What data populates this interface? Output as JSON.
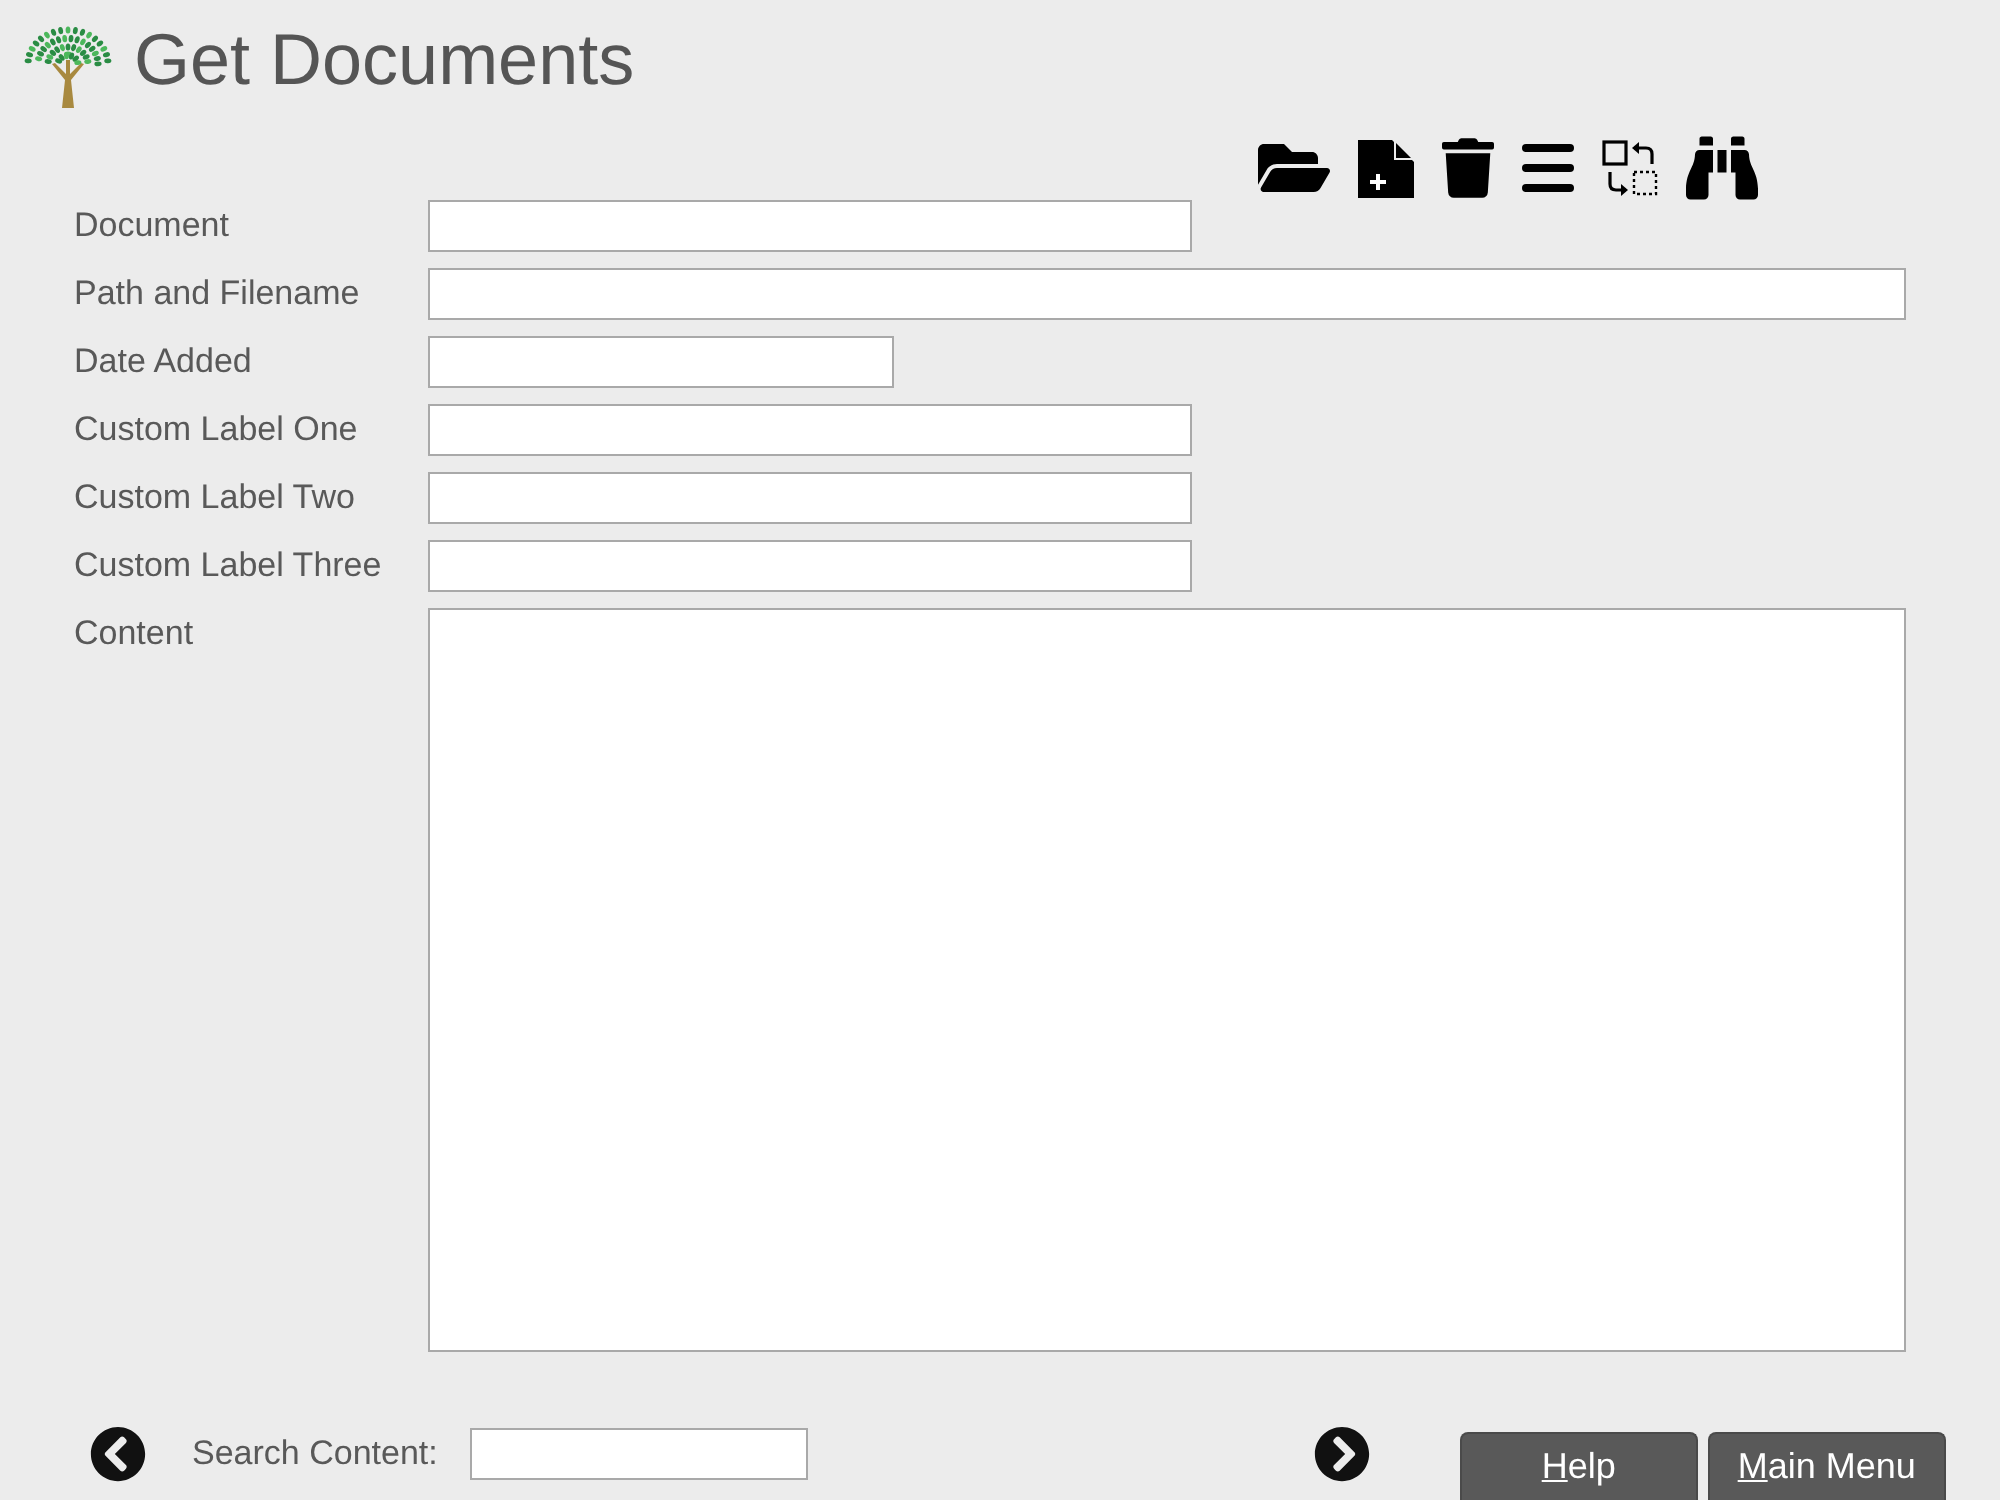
{
  "header": {
    "title": "Get Documents"
  },
  "form": {
    "fields": [
      {
        "label": "Document",
        "kind": "text"
      },
      {
        "label": "Path and Filename",
        "kind": "path"
      },
      {
        "label": "Date Added",
        "kind": "date"
      },
      {
        "label": "Custom Label One",
        "kind": "text"
      },
      {
        "label": "Custom Label Two",
        "kind": "text"
      },
      {
        "label": "Custom Label Three",
        "kind": "text"
      },
      {
        "label": "Content",
        "kind": "memo"
      }
    ]
  },
  "footer": {
    "search": {
      "label": "Search Content:"
    },
    "buttons": [
      {
        "label": "Help",
        "access_key_underlined": true
      },
      {
        "label": "Main Menu",
        "access_key_underlined": true
      }
    ]
  }
}
